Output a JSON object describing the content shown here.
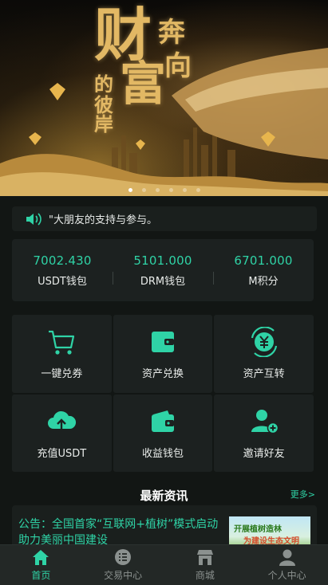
{
  "banner": {
    "chars": [
      "财",
      "富",
      "奔",
      "向",
      "的",
      "彼",
      "岸"
    ],
    "slide_count": 6,
    "active_slide": 0
  },
  "notice": {
    "icon": "speaker-icon",
    "text": "\"大朋友的支持与参与。"
  },
  "wallets": [
    {
      "value": "7002.430",
      "label": "USDT钱包"
    },
    {
      "value": "5101.000",
      "label": "DRM钱包"
    },
    {
      "value": "6701.000",
      "label": "M积分"
    }
  ],
  "actions": [
    {
      "label": "一键兑券",
      "icon": "cart-icon"
    },
    {
      "label": "资产兑换",
      "icon": "wallet-icon"
    },
    {
      "label": "资产互转",
      "icon": "yen-exchange-icon"
    },
    {
      "label": "充值USDT",
      "icon": "cloud-upload-icon"
    },
    {
      "label": "收益钱包",
      "icon": "purse-icon"
    },
    {
      "label": "邀请好友",
      "icon": "add-user-icon"
    }
  ],
  "news": {
    "title": "最新资讯",
    "more": "更多>",
    "item": {
      "text": "公告：全国首家“互联网+植树”模式启动助力美丽中国建设",
      "thumb_line1": "开展植树造林",
      "thumb_line2": "为建设生态文明"
    }
  },
  "tabbar": [
    {
      "label": "首页",
      "icon": "home-icon",
      "active": true
    },
    {
      "label": "交易中心",
      "icon": "list-icon",
      "active": false
    },
    {
      "label": "商城",
      "icon": "store-icon",
      "active": false
    },
    {
      "label": "个人中心",
      "icon": "user-icon",
      "active": false
    }
  ],
  "colors": {
    "accent": "#2fd3a6",
    "background": "#121614",
    "card": "#1c2120",
    "tabbar": "#232826",
    "banner_gold": "#e2b864"
  }
}
